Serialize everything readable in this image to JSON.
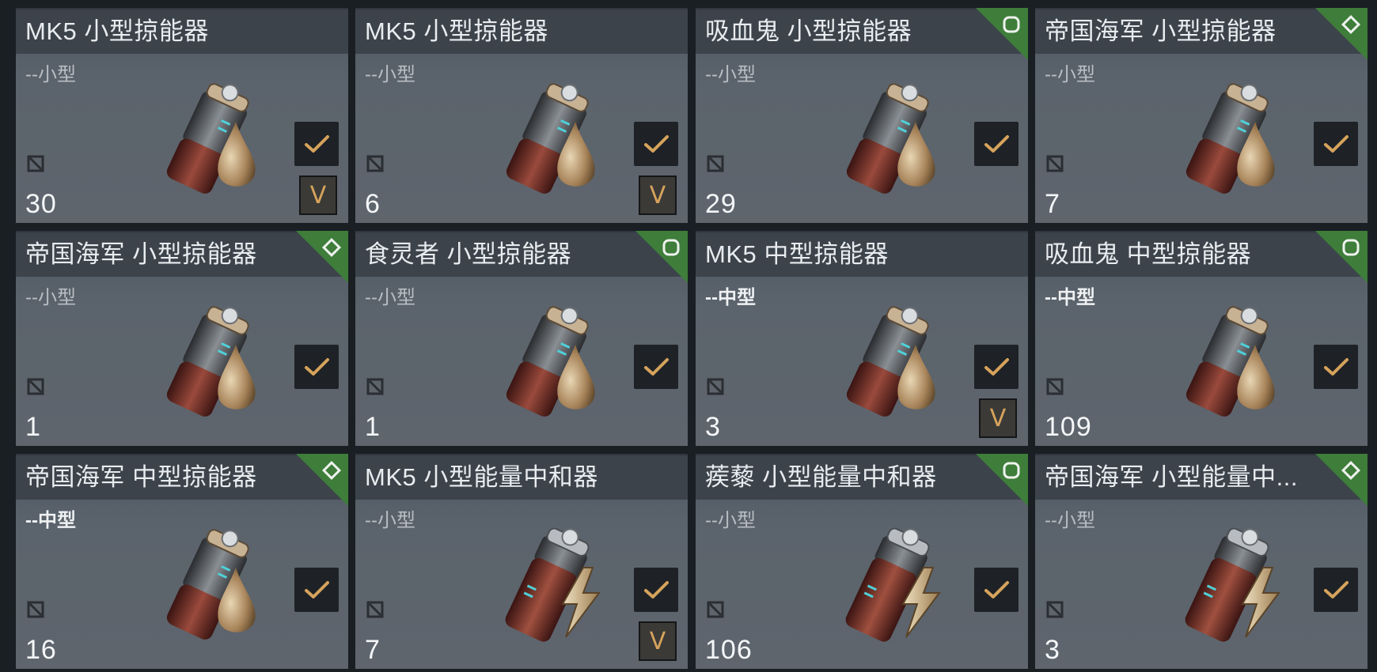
{
  "colors": {
    "card_bg": "#5b636c",
    "header_bg": "#3a4048",
    "corner_green": "#3e7d3a",
    "accent_gold": "#d6a35c"
  },
  "items": [
    {
      "title": "MK5 小型掠能器",
      "size": "--小型",
      "qty": "30",
      "corner": "",
      "v_button": "V",
      "art": "drop"
    },
    {
      "title": "MK5 小型掠能器",
      "size": "--小型",
      "qty": "6",
      "corner": "",
      "v_button": "V",
      "art": "drop"
    },
    {
      "title": "吸血鬼 小型掠能器",
      "size": "--小型",
      "qty": "29",
      "corner": "circle",
      "v_button": "",
      "art": "drop"
    },
    {
      "title": "帝国海军 小型掠能器",
      "size": "--小型",
      "qty": "7",
      "corner": "diamond",
      "v_button": "",
      "art": "drop"
    },
    {
      "title": "帝国海军 小型掠能器",
      "size": "--小型",
      "qty": "1",
      "corner": "diamond",
      "v_button": "",
      "art": "drop"
    },
    {
      "title": "食灵者 小型掠能器",
      "size": "--小型",
      "qty": "1",
      "corner": "circle",
      "v_button": "",
      "art": "drop"
    },
    {
      "title": "MK5 中型掠能器",
      "size": "--中型",
      "qty": "3",
      "corner": "",
      "v_button": "V",
      "art": "drop"
    },
    {
      "title": "吸血鬼 中型掠能器",
      "size": "--中型",
      "qty": "109",
      "corner": "circle",
      "v_button": "",
      "art": "drop"
    },
    {
      "title": "帝国海军 中型掠能器",
      "size": "--中型",
      "qty": "16",
      "corner": "diamond",
      "v_button": "",
      "art": "drop"
    },
    {
      "title": "MK5 小型能量中和器",
      "size": "--小型",
      "qty": "7",
      "corner": "",
      "v_button": "V",
      "art": "bolt"
    },
    {
      "title": "蒺藜 小型能量中和器",
      "size": "--小型",
      "qty": "106",
      "corner": "circle",
      "v_button": "",
      "art": "bolt"
    },
    {
      "title": "帝国海军 小型能量中...",
      "size": "--小型",
      "qty": "3",
      "corner": "diamond",
      "v_button": "",
      "art": "bolt"
    }
  ]
}
